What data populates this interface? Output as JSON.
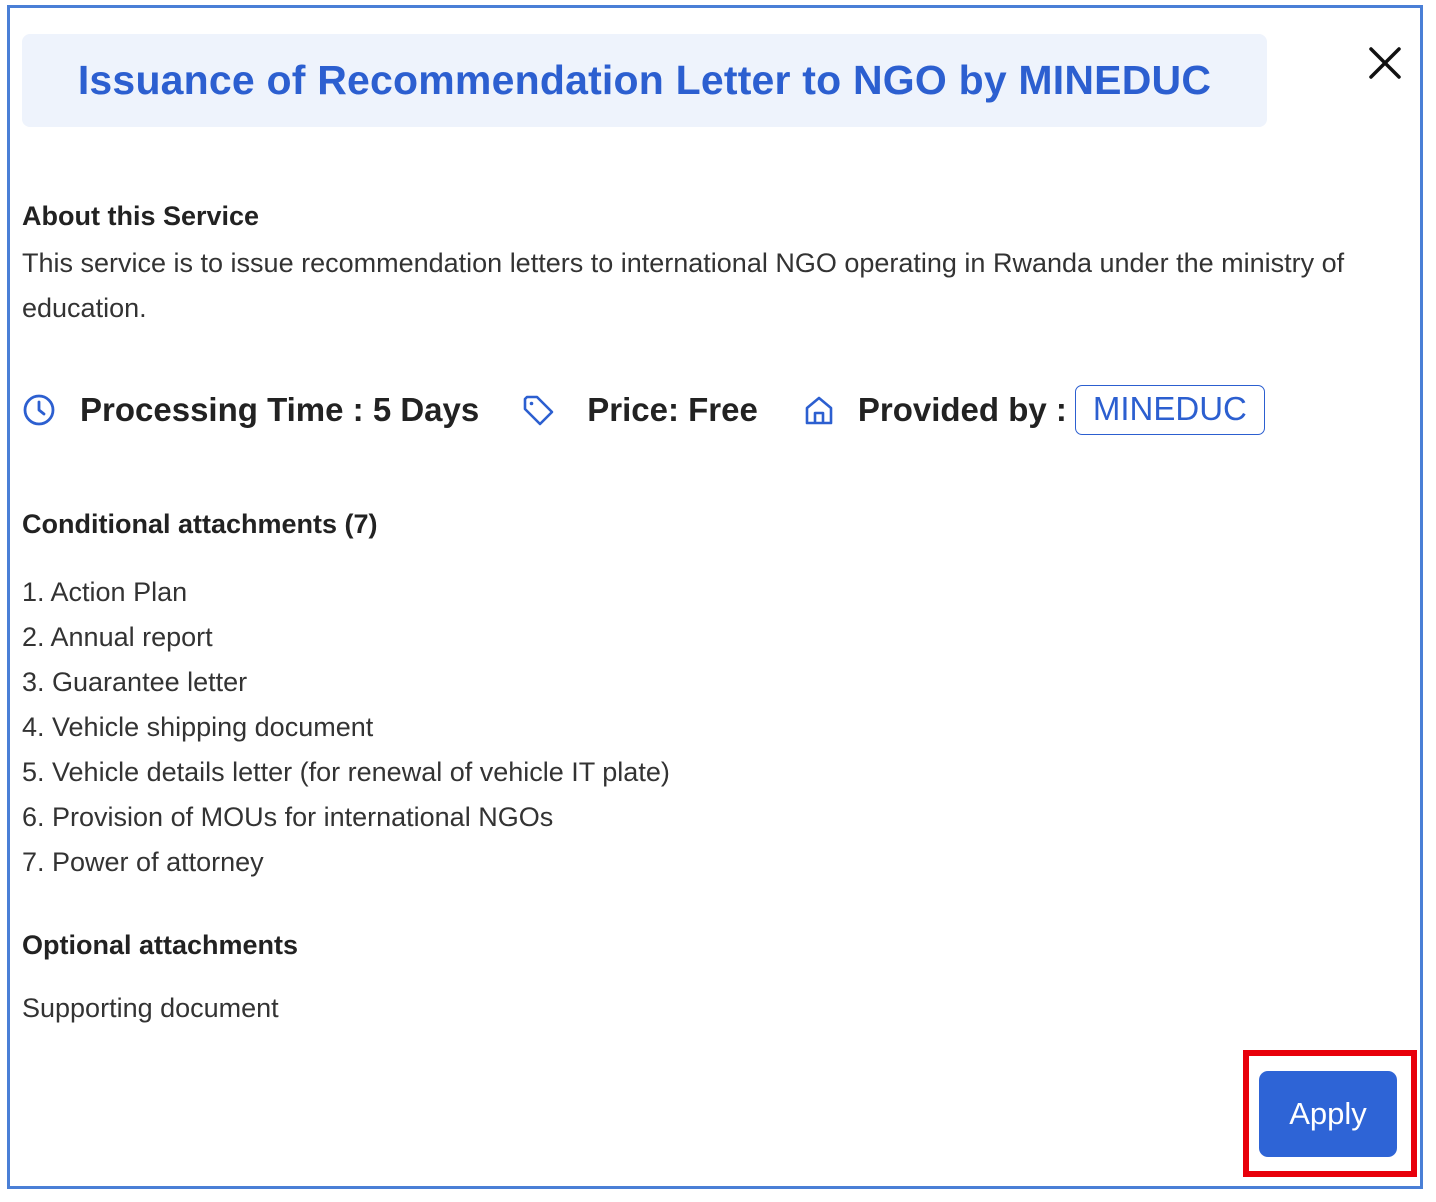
{
  "dialog": {
    "title": "Issuance of Recommendation Letter to NGO by MINEDUC",
    "close_icon": "close-icon"
  },
  "about": {
    "heading": "About this Service",
    "description": "This service is to issue recommendation letters to international NGO operating in Rwanda under the ministry of education."
  },
  "meta": {
    "processing_time": "Processing Time : 5 Days",
    "processing_icon": "clock-icon",
    "price": "Price: Free",
    "price_icon": "tag-icon",
    "provided_by_label": "Provided by :",
    "provided_by_icon": "home-icon",
    "provider": "MINEDUC"
  },
  "conditional_attachments": {
    "heading": "Conditional attachments (7)",
    "items": [
      "1. Action Plan",
      "2. Annual report",
      "3. Guarantee letter",
      "4. Vehicle shipping document",
      "5. Vehicle details letter (for renewal of vehicle IT plate)",
      "6. Provision of MOUs for international NGOs",
      "7. Power of attorney"
    ]
  },
  "optional_attachments": {
    "heading": "Optional attachments",
    "text": "Supporting document"
  },
  "actions": {
    "apply_label": "Apply"
  },
  "colors": {
    "accent": "#2c5fd0",
    "button": "#2e64d6",
    "title_background": "#eef3fc",
    "border": "#4a7fd6",
    "highlight": "#e8000b"
  }
}
